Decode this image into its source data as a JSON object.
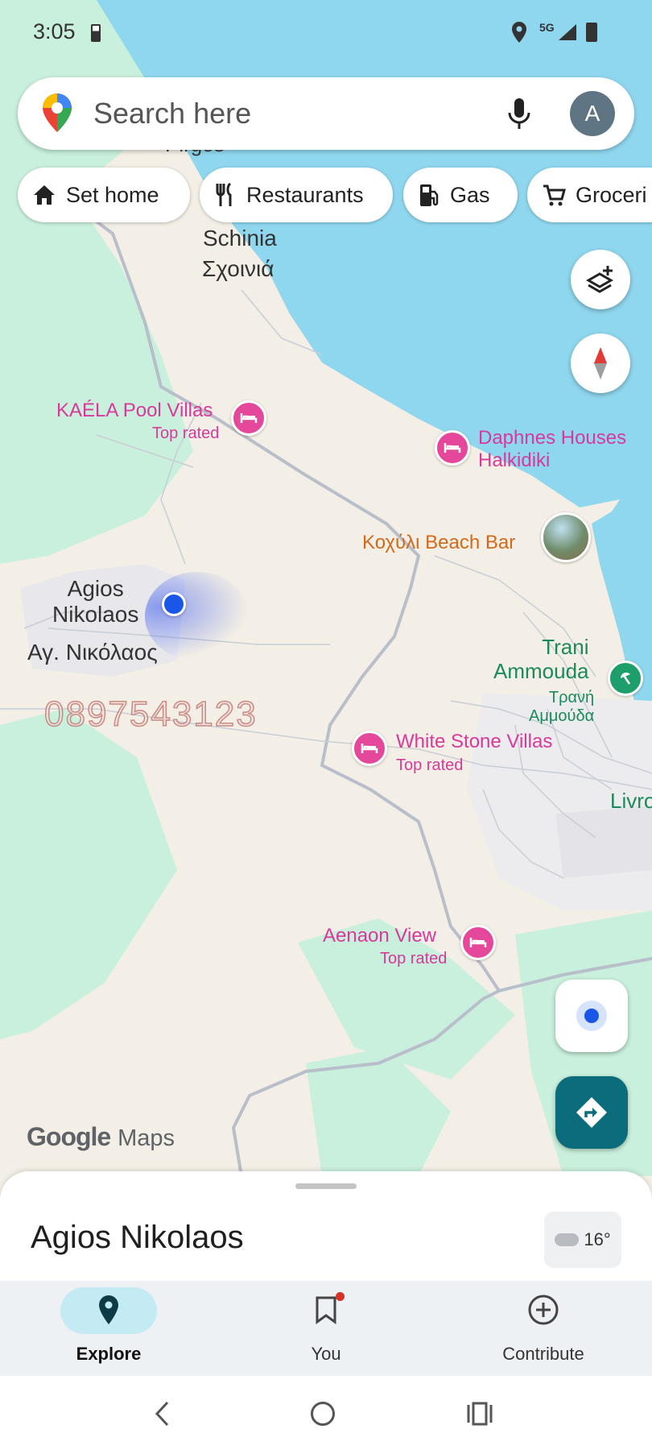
{
  "status_bar": {
    "time": "3:05",
    "network": "5G"
  },
  "search": {
    "placeholder": "Search here",
    "avatar_initial": "A"
  },
  "chips": [
    {
      "label": "Set home",
      "icon": "home-icon"
    },
    {
      "label": "Restaurants",
      "icon": "fork-knife-icon"
    },
    {
      "label": "Gas",
      "icon": "gas-pump-icon"
    },
    {
      "label": "Groceri",
      "icon": "cart-icon"
    }
  ],
  "map": {
    "places": {
      "pirgos": "Pirgos",
      "schinia": "Schinia",
      "schinia_gr": "Σχοινιά",
      "agios_nikolaos": "Agios\nNikolaos",
      "agios_nikolaos_gr": "Αγ. Νικόλαος",
      "trani": "Trani\nAmmouda",
      "trani_gr": "Τρανή\nΑμμούδα",
      "livro": "Livro"
    },
    "pois": {
      "kaela": {
        "name": "KAÉLA Pool Villas",
        "sub": "Top rated"
      },
      "daphnes": {
        "name": "Daphnes Houses\nHalkidiki"
      },
      "beach_bar": {
        "name": "Κοχύλι Beach Bar"
      },
      "white_stone": {
        "name": "White Stone Villas",
        "sub": "Top rated"
      },
      "aenaon": {
        "name": "Aenaon View",
        "sub": "Top rated"
      }
    },
    "watermark": "0897543123",
    "brand": {
      "google": "Google",
      "maps": "Maps"
    }
  },
  "sheet": {
    "title": "Agios Nikolaos",
    "weather": "16°"
  },
  "nav": {
    "explore": "Explore",
    "you": "You",
    "contribute": "Contribute"
  },
  "colors": {
    "water": "#8fd7ee",
    "land": "#f3efe6",
    "park": "#c9f0dc",
    "poi_pink": "#e5489a",
    "poi_orange": "#d36a1a",
    "poi_green": "#1e9e6a",
    "accent_teal": "#0b6d7c"
  }
}
